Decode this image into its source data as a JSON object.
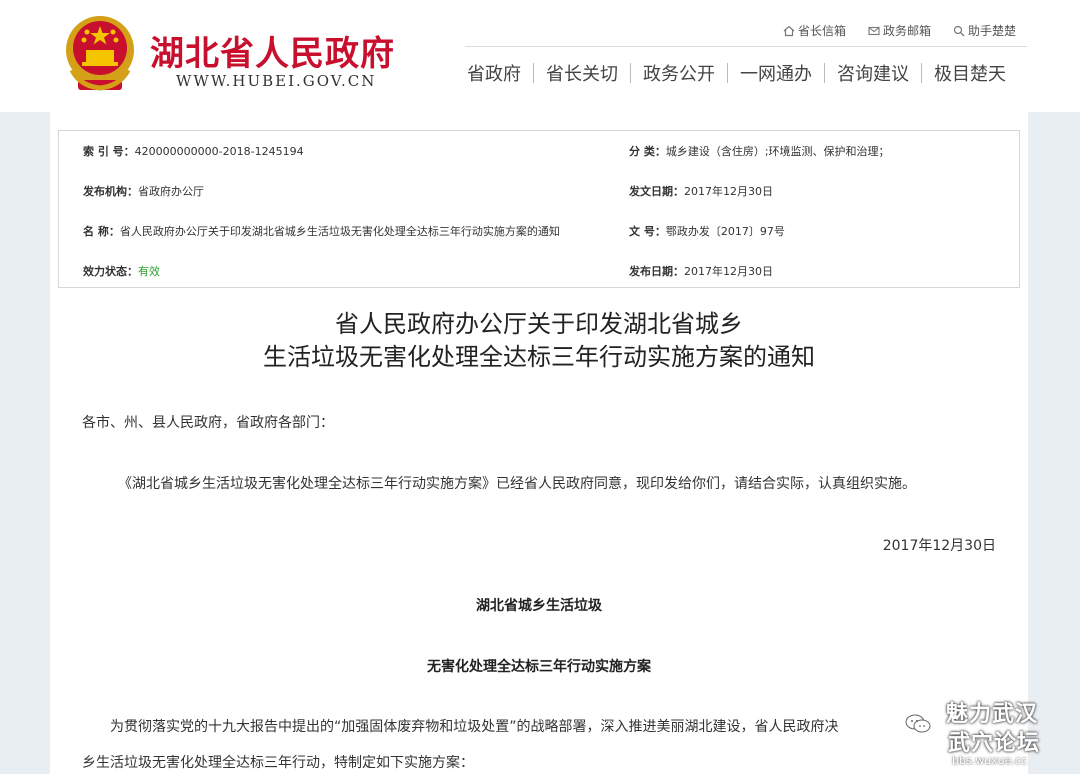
{
  "header": {
    "site_title": "湖北省人民政府",
    "site_url": "WWW.HUBEI.GOV.CN",
    "top_links": [
      {
        "label": "省长信箱",
        "icon": "home-icon"
      },
      {
        "label": "政务邮箱",
        "icon": "mail-icon"
      },
      {
        "label": "助手楚楚",
        "icon": "search-icon"
      }
    ],
    "nav": [
      "省政府",
      "省长关切",
      "政务公开",
      "一网通办",
      "咨询建议",
      "极目楚天"
    ]
  },
  "meta": {
    "index_label": "索 引 号：",
    "index_value": "420000000000-2018-1245194",
    "category_label": "分    类：",
    "category_value": "城乡建设（含住房）;环境监测、保护和治理；",
    "issuer_label": "发布机构：",
    "issuer_value": "省政府办公厅",
    "doc_date_label": "发文日期：",
    "doc_date_value": "2017年12月30日",
    "name_label": "名    称：",
    "name_value": "省人民政府办公厅关于印发湖北省城乡生活垃圾无害化处理全达标三年行动实施方案的通知",
    "doc_no_label": "文    号：",
    "doc_no_value": "鄂政办发〔2017〕97号",
    "status_label": "效力状态：",
    "status_value": "有效",
    "pub_date_label": "发布日期：",
    "pub_date_value": "2017年12月30日"
  },
  "document": {
    "title_line1": "省人民政府办公厅关于印发湖北省城乡",
    "title_line2": "生活垃圾无害化处理全达标三年行动实施方案的通知",
    "addressee": "各市、州、县人民政府，省政府各部门：",
    "body": "《湖北省城乡生活垃圾无害化处理全达标三年行动实施方案》已经省人民政府同意，现印发给你们，请结合实际，认真组织实施。",
    "date": "2017年12月30日",
    "subtitle1": "湖北省城乡生活垃圾",
    "subtitle2": "无害化处理全达标三年行动实施方案",
    "intro_line1": "为贯彻落实党的十九大报告中提出的“加强固体废弃物和垃圾处置”的战略部署，深入推进美丽湖北建设，省人民政府决",
    "intro_line2": "乡生活垃圾无害化处理全达标三年行动，特制定如下实施方案："
  },
  "watermark": {
    "title": "魅力武汉",
    "subtitle": "武穴论坛",
    "url": "bbs.wuxue.cc"
  },
  "colors": {
    "brand_red": "#c8102e",
    "valid_green": "#2e9d2e",
    "page_bg": "#e9eef3"
  }
}
